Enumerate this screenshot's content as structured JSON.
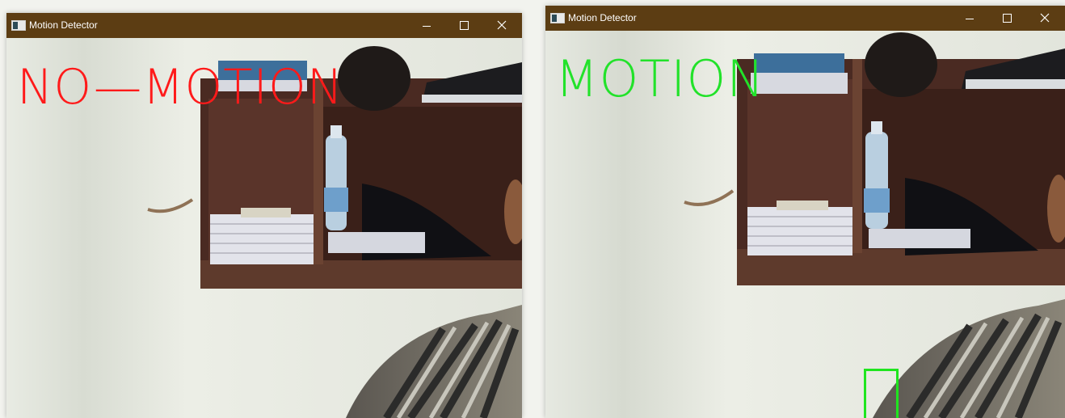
{
  "windows": [
    {
      "title": "Motion Detector",
      "status_text": "NO—MOTION",
      "status_color": "#ff1a1a",
      "motion_box_visible": false
    },
    {
      "title": "Motion Detector",
      "status_text": "MOTION",
      "status_color": "#22e22a",
      "motion_box_visible": true
    }
  ],
  "titlebar_color": "#5c3d13",
  "controls": [
    "minimize-icon",
    "maximize-icon",
    "close-icon"
  ]
}
